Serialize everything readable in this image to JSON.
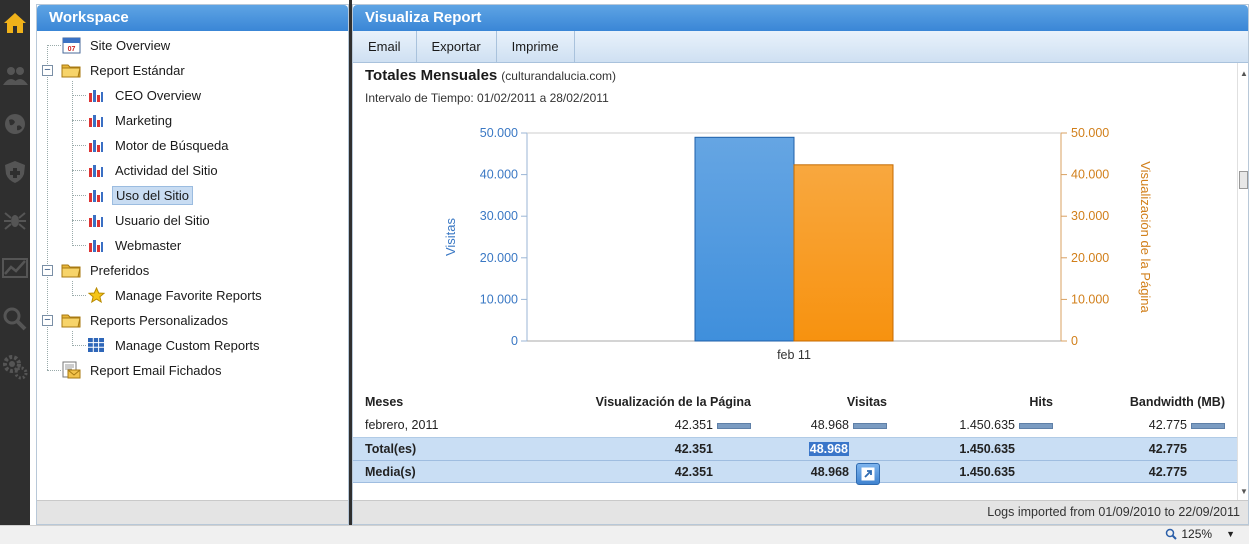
{
  "rail": {
    "icons": [
      "home-icon",
      "users-icon",
      "globe-icon",
      "shield-icon",
      "spider-icon",
      "trend-icon",
      "search-icon",
      "gears-icon"
    ]
  },
  "workspace": {
    "title": "Workspace",
    "tree": [
      {
        "label": "Site Overview",
        "icon": "calendar-icon",
        "calendar_day": "07"
      },
      {
        "label": "Report Estándar",
        "icon": "folder-icon"
      },
      {
        "label": "CEO Overview",
        "icon": "chart-icon"
      },
      {
        "label": "Marketing",
        "icon": "chart-icon"
      },
      {
        "label": "Motor de Búsqueda",
        "icon": "chart-icon"
      },
      {
        "label": "Actividad del Sitio",
        "icon": "chart-icon"
      },
      {
        "label": "Uso del Sitio",
        "icon": "chart-icon",
        "selected": true
      },
      {
        "label": "Usuario del Sitio",
        "icon": "chart-icon"
      },
      {
        "label": "Webmaster",
        "icon": "chart-icon"
      },
      {
        "label": "Preferidos",
        "icon": "folder-icon"
      },
      {
        "label": "Manage Favorite Reports",
        "icon": "star-icon"
      },
      {
        "label": "Reports Personalizados",
        "icon": "folder-icon"
      },
      {
        "label": "Manage Custom Reports",
        "icon": "grid-icon"
      },
      {
        "label": "Report Email Fichados",
        "icon": "email-report-icon"
      }
    ]
  },
  "report": {
    "title": "Visualiza Report",
    "toolbar": {
      "email": "Email",
      "export": "Exportar",
      "print": "Imprime"
    },
    "heading": "Totales Mensuales",
    "domain": "(culturandalucia.com)",
    "interval": "Intervalo de Tiempo:  01/02/2011 a 28/02/2011",
    "footer": "Logs imported from 01/09/2010 to 22/09/2011"
  },
  "chart_data": {
    "type": "bar",
    "categories": [
      "feb 11"
    ],
    "series": [
      {
        "name": "Visitas",
        "values": [
          48968
        ],
        "color": "#3f8fdc",
        "axis": "left"
      },
      {
        "name": "Visualización de la Página",
        "values": [
          42351
        ],
        "color": "#f7920f",
        "axis": "right"
      }
    ],
    "ylabel_left": "Visitas",
    "ylabel_right": "Visualización de la Página",
    "ylim": [
      0,
      50000
    ],
    "yticks": [
      "0",
      "10.000",
      "20.000",
      "30.000",
      "40.000",
      "50.000"
    ],
    "grid": false
  },
  "table": {
    "headers": [
      "Meses",
      "Visualización de la Página",
      "Visitas",
      "Hits",
      "Bandwidth (MB)"
    ],
    "row": {
      "month": "febrero, 2011",
      "pageviews": "42.351",
      "visits": "48.968",
      "hits": "1.450.635",
      "bandwidth": "42.775"
    },
    "total": {
      "label": "Total(es)",
      "pageviews": "42.351",
      "visits": "48.968",
      "hits": "1.450.635",
      "bandwidth": "42.775"
    },
    "average": {
      "label": "Media(s)",
      "pageviews": "42.351",
      "visits": "48.968",
      "hits": "1.450.635",
      "bandwidth": "42.775"
    }
  },
  "statusbar": {
    "zoom": "125%"
  }
}
